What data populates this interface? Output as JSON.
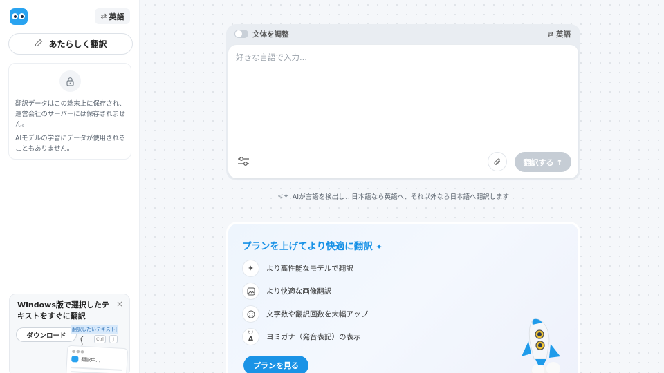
{
  "sidebar": {
    "lang_toggle": {
      "icon": "swap-icon",
      "label": "英語"
    },
    "new_translation": {
      "icon": "pen-icon",
      "label": "あたらしく翻訳"
    },
    "privacy": {
      "icon": "lock-icon",
      "text1": "翻訳データはこの端末上に保存され、運営会社のサーバーには保存されません。",
      "text2": "AIモデルの学習にデータが使用されることもありません。"
    },
    "windows_promo": {
      "title": "Windows版で選択したテキストをすぐに翻訳",
      "close_icon": "×",
      "download_label": "ダウンロード",
      "illustration": {
        "highlight_text": "翻訳したいテキスト|",
        "key_ctrl": "Ctrl",
        "key_j": "J",
        "mini_window_text": "翻訳中..."
      }
    }
  },
  "editor": {
    "style_toggle_label": "文体を調整",
    "target_lang": {
      "icon": "swap-icon",
      "label": "英語"
    },
    "input": {
      "value": "",
      "placeholder": "好きな言語で入力..."
    },
    "translate_button": "翻訳する ↑"
  },
  "hint": "AIが言語を検出し、日本語なら英語へ、それ以外なら日本語へ翻訳します",
  "plan": {
    "title": "プランを上げてより快適に翻訳",
    "features": [
      {
        "icon": "sparkle-icon",
        "label": "より高性能なモデルで翻訳"
      },
      {
        "icon": "image-icon",
        "label": "より快適な画像翻訳"
      },
      {
        "icon": "smile-icon",
        "label": "文字数や翻訳回数を大幅アップ"
      },
      {
        "icon": "kana-icon",
        "icon_top": "カナ",
        "icon_main": "A",
        "label": "ヨミガナ（発音表記）の表示"
      }
    ],
    "cta": "プランを見る"
  },
  "colors": {
    "brand": "#29a3f0",
    "accent": "#1a93e6",
    "disabled_button": "#c6cdd5",
    "background": "#f5f7fa"
  }
}
